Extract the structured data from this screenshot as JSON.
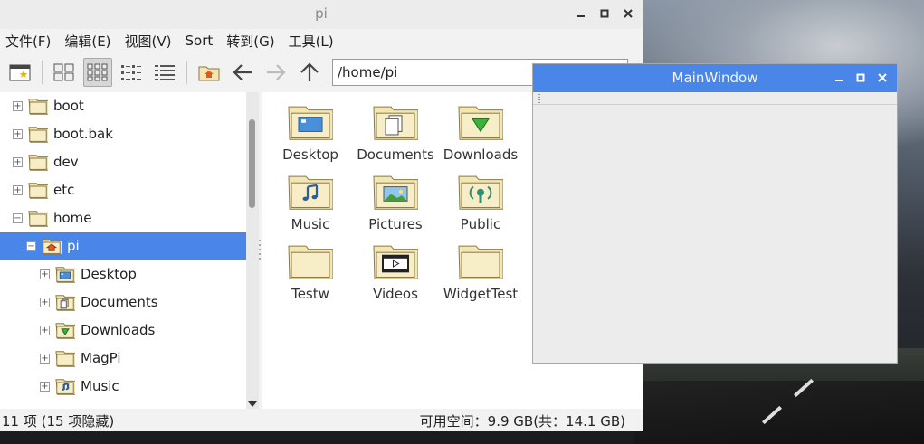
{
  "file_manager": {
    "title": "pi",
    "menu": [
      "文件(F)",
      "编辑(E)",
      "视图(V)",
      "Sort",
      "转到(G)",
      "工具(L)"
    ],
    "path": "/home/pi",
    "tree": [
      {
        "label": "boot",
        "expander": "+",
        "icon": "folder-icon"
      },
      {
        "label": "boot.bak",
        "expander": "+",
        "icon": "folder-icon"
      },
      {
        "label": "dev",
        "expander": "+",
        "icon": "folder-icon"
      },
      {
        "label": "etc",
        "expander": "+",
        "icon": "folder-icon"
      },
      {
        "label": "home",
        "expander": "−",
        "icon": "folder-icon"
      },
      {
        "label": "pi",
        "expander": "−",
        "icon": "home-folder-icon",
        "selected": true
      },
      {
        "label": "Desktop",
        "expander": "+",
        "icon": "desktop-folder-icon"
      },
      {
        "label": "Documents",
        "expander": "+",
        "icon": "documents-folder-icon"
      },
      {
        "label": "Downloads",
        "expander": "+",
        "icon": "downloads-folder-icon"
      },
      {
        "label": "MagPi",
        "expander": "+",
        "icon": "folder-icon"
      },
      {
        "label": "Music",
        "expander": "+",
        "icon": "music-folder-icon"
      }
    ],
    "items": [
      {
        "label": "Desktop",
        "icon": "desktop-folder-icon"
      },
      {
        "label": "Documents",
        "icon": "documents-folder-icon"
      },
      {
        "label": "Downloads",
        "icon": "downloads-folder-icon"
      },
      {
        "label": "Music",
        "icon": "music-folder-icon"
      },
      {
        "label": "Pictures",
        "icon": "pictures-folder-icon"
      },
      {
        "label": "Public",
        "icon": "public-folder-icon"
      },
      {
        "label": "Testw",
        "icon": "folder-icon"
      },
      {
        "label": "Videos",
        "icon": "videos-folder-icon"
      },
      {
        "label": "WidgetTest",
        "icon": "folder-icon"
      }
    ],
    "status_left": "11 项 (15 项隐藏)",
    "status_right": "可用空间：9.9 GB(共：14.1 GB)"
  },
  "main_window": {
    "title": "MainWindow"
  },
  "colors": {
    "selection": "#4a86e8",
    "folder": "#f3e6b3",
    "folder_border": "#8a7a45"
  }
}
